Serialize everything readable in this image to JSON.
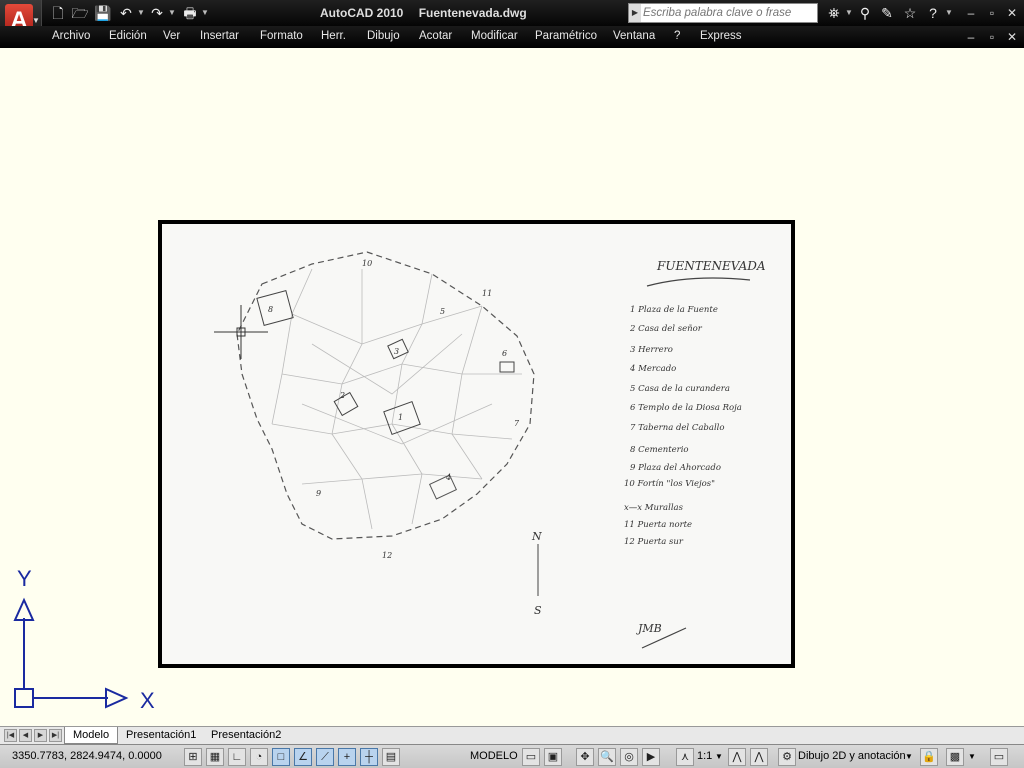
{
  "title_bar": {
    "app_name": "AutoCAD 2010",
    "file_name": "Fuentenevada.dwg",
    "search_placeholder": "Escriba palabra clave o frase",
    "quick_access_icons": [
      "new-icon",
      "open-icon",
      "save-icon",
      "undo-icon",
      "redo-icon",
      "plot-icon"
    ],
    "toolbar_icons": [
      "binoculars-icon",
      "satellite-icon",
      "comm-center-icon",
      "favorites-star-icon",
      "help-icon"
    ]
  },
  "menu": {
    "items": [
      "Archivo",
      "Edición",
      "Ver",
      "Insertar",
      "Formato",
      "Herr.",
      "Dibujo",
      "Acotar",
      "Modificar",
      "Paramétrico",
      "Ventana",
      "?",
      "Express"
    ]
  },
  "window_controls": {
    "app": [
      "–",
      "▫",
      "✕"
    ],
    "doc": [
      "–",
      "▫",
      "✕"
    ]
  },
  "drawing": {
    "ucs": {
      "y_label": "Y",
      "x_label": "X"
    },
    "sketch": {
      "title": "FUENTENEVADA",
      "legend": [
        "1  Plaza de la Fuente",
        "2  Casa del señor",
        "3  Herrero",
        "4  Mercado",
        "5  Casa de la curandera",
        "6  Templo de la Diosa Roja",
        "7  Taberna del Caballo",
        "8  Cementerio",
        "9  Plaza del Ahorcado",
        "10  Fortín \"los Viejos\""
      ],
      "legend_extra": [
        "x—x  Murallas",
        "11  Puerta norte",
        "12  Puerta sur"
      ],
      "compass": {
        "north": "N",
        "south": "S"
      },
      "signature": "JMB",
      "map_labels": [
        "10",
        "11",
        "8",
        "5",
        "6",
        "3",
        "2",
        "1",
        "4",
        "9",
        "7",
        "12"
      ]
    }
  },
  "tabs": {
    "items": [
      "Modelo",
      "Presentación1",
      "Presentación2"
    ],
    "active": "Modelo"
  },
  "status_bar": {
    "coordinates": "3350.7783, 2824.9474, 0.0000",
    "model_label": "MODELO",
    "scale": "1:1",
    "workspace": "Dibujo 2D y anotación",
    "toggle_icons": [
      "snap-icon",
      "grid-icon",
      "ortho-icon",
      "polar-icon",
      "osnap-icon",
      "otrack-icon",
      "ducs-icon",
      "dyn-icon",
      "lineweight-icon",
      "qp-icon"
    ]
  }
}
